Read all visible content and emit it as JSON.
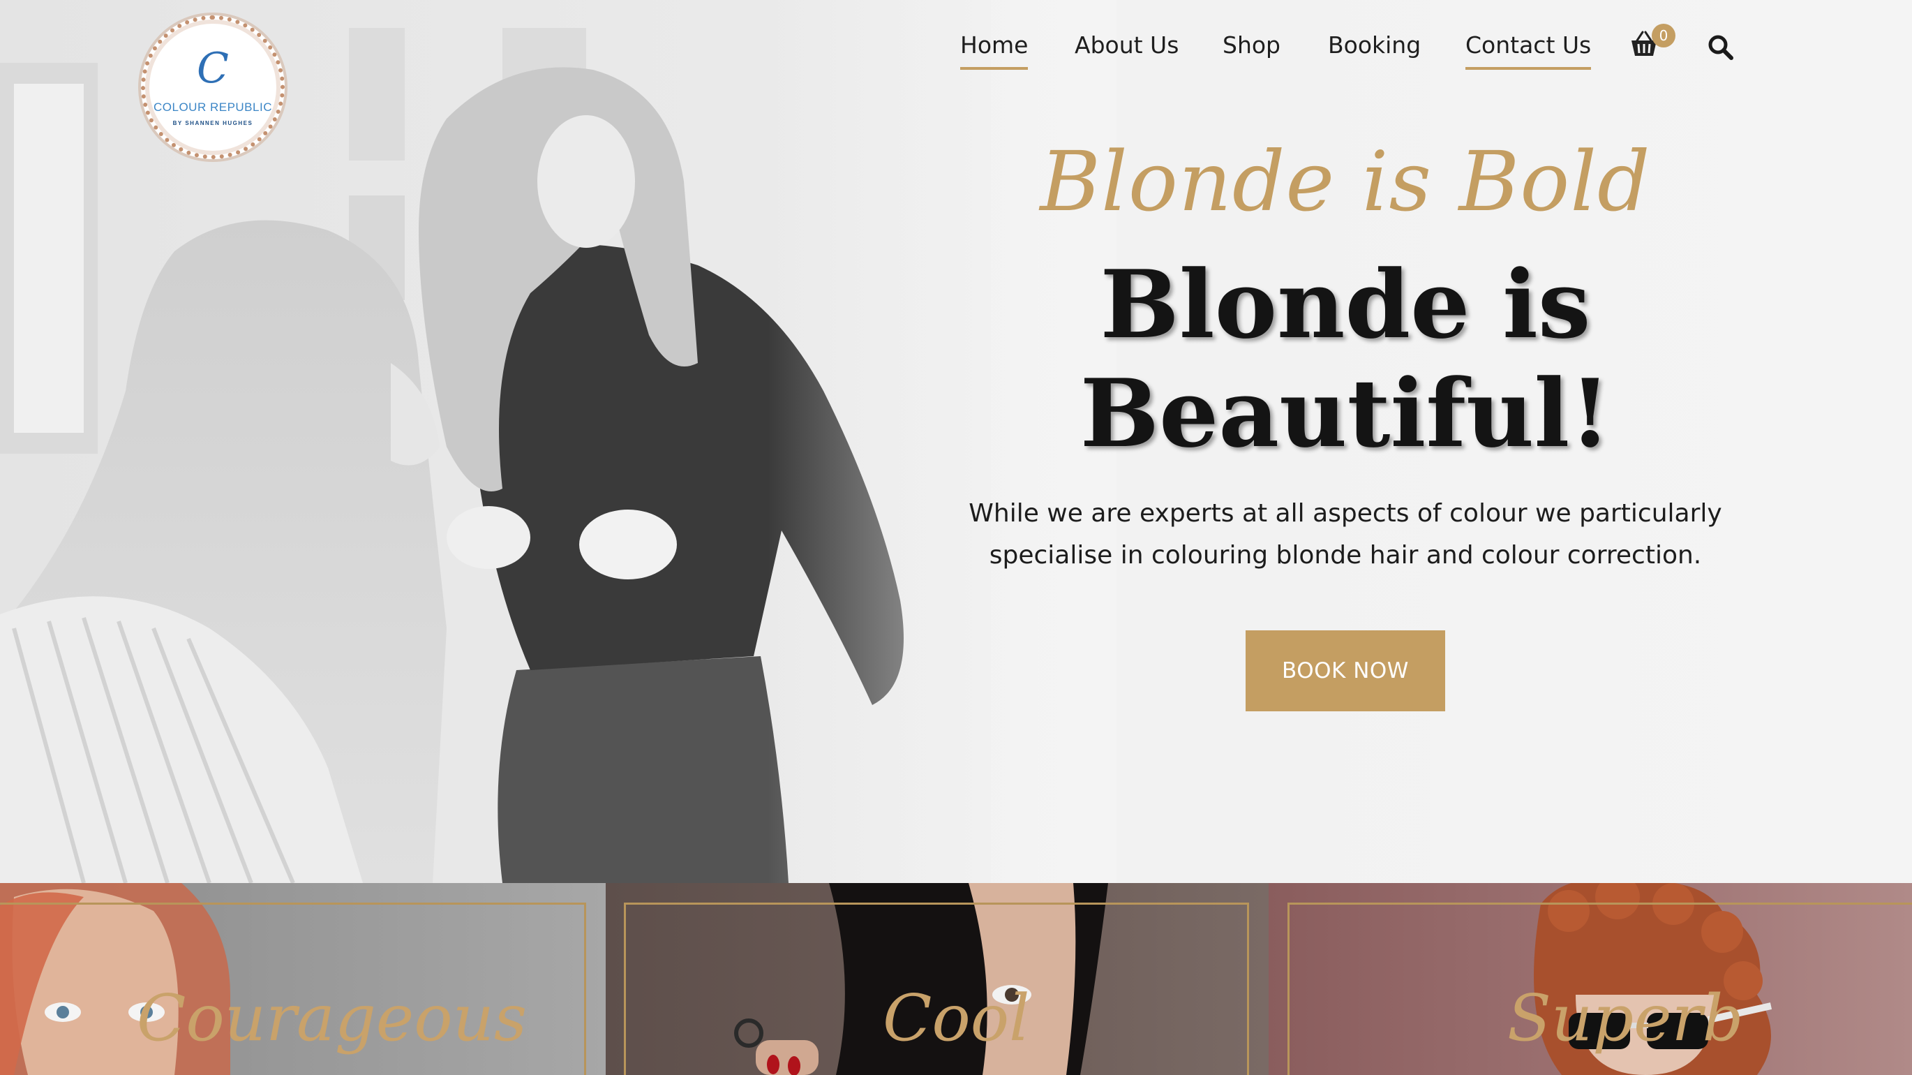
{
  "brand": {
    "logo_letter": "C",
    "logo_name": "COLOUR REPUBLIC",
    "logo_tagline": "BY SHANNEN HUGHES"
  },
  "nav": {
    "items": [
      {
        "label": "Home",
        "active": true
      },
      {
        "label": "About Us",
        "active": false
      },
      {
        "label": "Shop",
        "active": false
      },
      {
        "label": "Booking",
        "active": false
      },
      {
        "label": "Contact Us",
        "active": true
      }
    ],
    "cart_count": "0",
    "cart_icon": "basket-icon",
    "search_icon": "search-icon"
  },
  "hero": {
    "script_title": "Blonde is Bold",
    "title_line1": "Blonde is",
    "title_line2": "Beautiful!",
    "description_line1": "While we are experts at all aspects of colour we particularly",
    "description_line2": "specialise in colouring blonde hair and colour correction.",
    "cta_label": "BOOK NOW"
  },
  "cards": [
    {
      "label": "Courageous"
    },
    {
      "label": "Cool"
    },
    {
      "label": "Superb"
    }
  ],
  "colors": {
    "accent": "#c49e62",
    "text_dark": "#141414",
    "logo_blue": "#2e6fb5"
  }
}
